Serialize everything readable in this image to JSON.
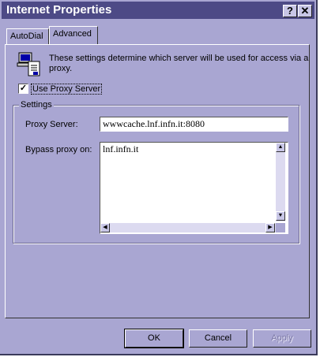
{
  "window": {
    "title": "Internet Properties",
    "help_button": "?",
    "close_button": "✕"
  },
  "tabs": [
    {
      "label": "AutoDial",
      "selected": false
    },
    {
      "label": "Advanced",
      "selected": true
    }
  ],
  "description": "These settings determine which server will be used for access via a proxy.",
  "use_proxy": {
    "label": "Use Proxy Server",
    "checked": true,
    "mark": "✓"
  },
  "settings_group": {
    "label": "Settings",
    "proxy_server_label": "Proxy Server:",
    "proxy_server_value": "wwwcache.lnf.infn.it:8080",
    "bypass_label": "Bypass proxy on:",
    "bypass_value": "lnf.infn.it"
  },
  "scroll_icons": {
    "up": "▲",
    "down": "▼",
    "left": "◀",
    "right": "▶"
  },
  "buttons": {
    "ok": "OK",
    "cancel": "Cancel",
    "apply": "Apply"
  },
  "colors": {
    "window_bg": "#a9a6d2",
    "titlebar": "#4d4a86"
  }
}
